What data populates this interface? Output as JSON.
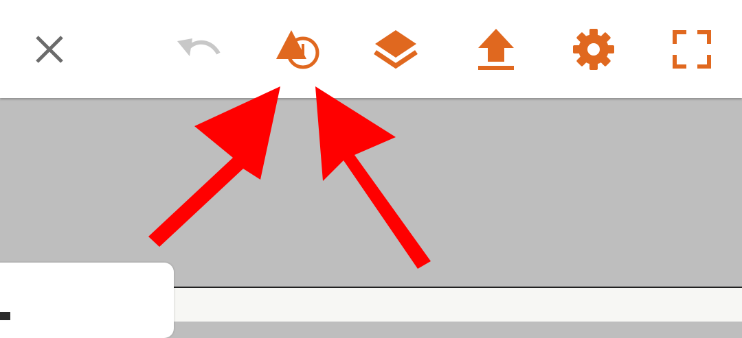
{
  "colors": {
    "accent": "#e0681f",
    "disabled": "#c8c8c8",
    "close": "#6b6b6b",
    "annotation_arrow": "#ff0000",
    "canvas_background": "#bebebe"
  },
  "toolbar": {
    "buttons": [
      {
        "id": "close",
        "icon": "close-icon",
        "state": "enabled"
      },
      {
        "id": "undo",
        "icon": "undo-icon",
        "state": "disabled"
      },
      {
        "id": "shapes",
        "icon": "shapes-icon",
        "state": "enabled"
      },
      {
        "id": "layers",
        "icon": "layers-icon",
        "state": "enabled"
      },
      {
        "id": "upload",
        "icon": "upload-icon",
        "state": "enabled"
      },
      {
        "id": "settings",
        "icon": "gear-icon",
        "state": "enabled"
      },
      {
        "id": "fullscreen",
        "icon": "fullscreen-icon",
        "state": "enabled"
      }
    ]
  },
  "annotations": [
    {
      "type": "arrow",
      "points_to": "shapes-icon",
      "side": "left"
    },
    {
      "type": "arrow",
      "points_to": "shapes-icon",
      "side": "right"
    }
  ]
}
